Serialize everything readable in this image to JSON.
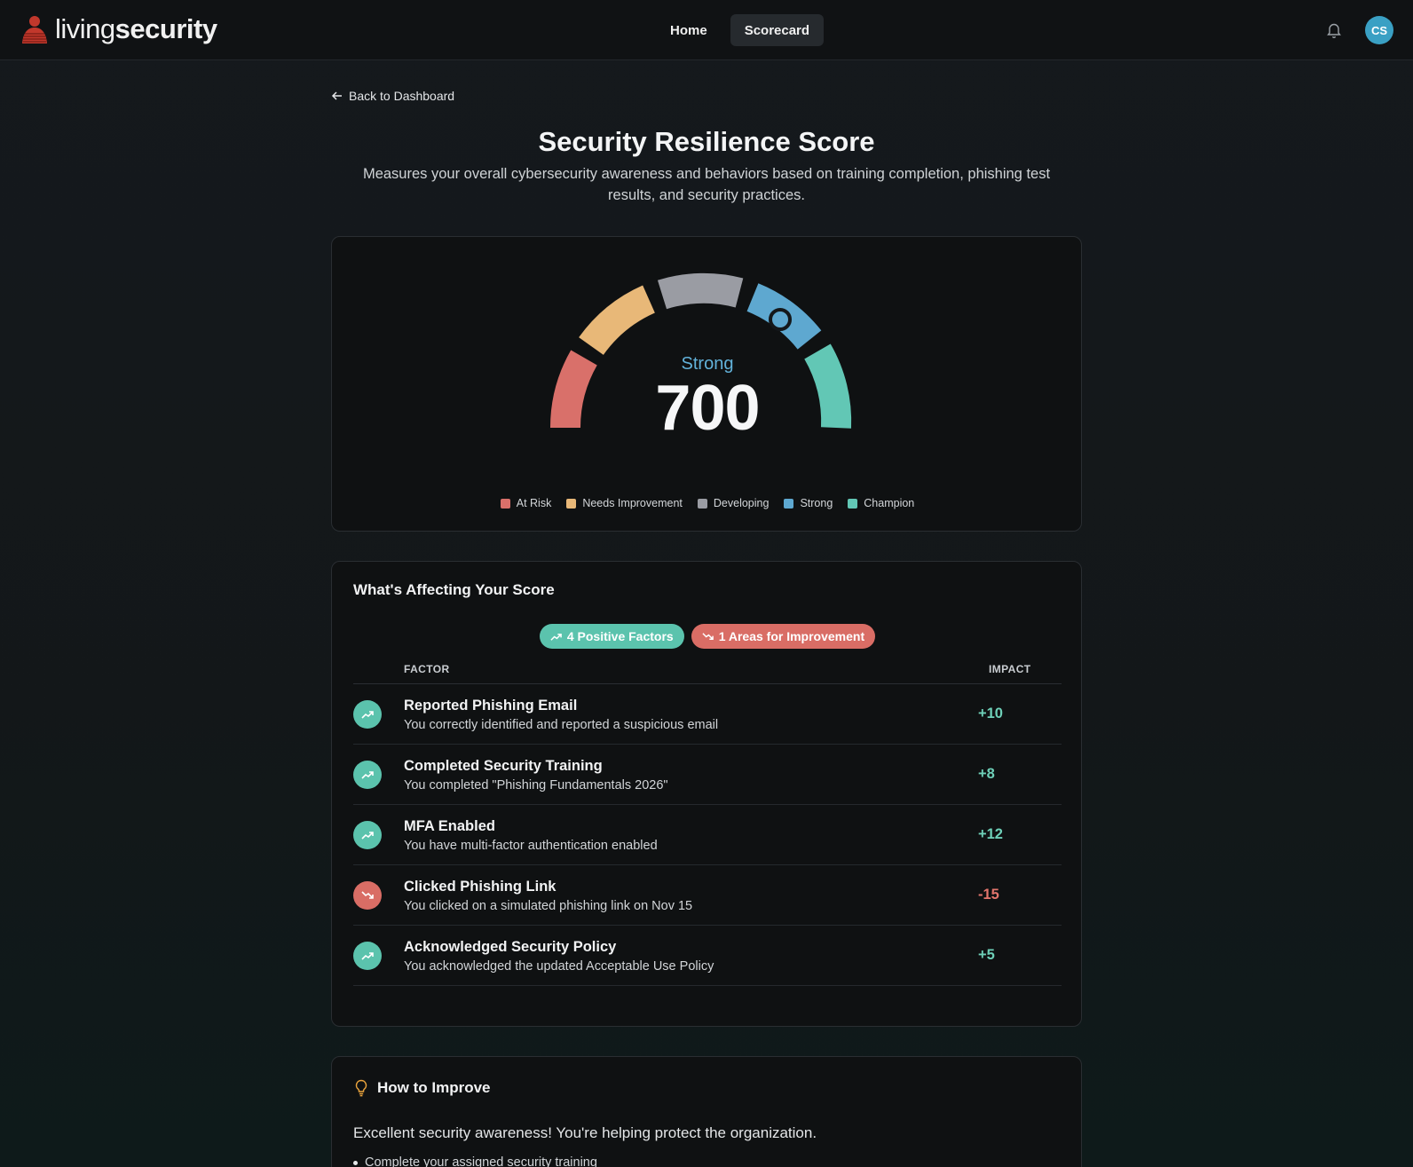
{
  "header": {
    "logo_light": "living",
    "logo_bold": "security",
    "nav": [
      {
        "label": "Home",
        "active": false
      },
      {
        "label": "Scorecard",
        "active": true
      }
    ],
    "notification_icon": "bell-icon",
    "avatar_initials": "CS"
  },
  "back_link": "Back to Dashboard",
  "page": {
    "title": "Security Resilience Score",
    "subtitle": "Measures your overall cybersecurity awareness and behaviors based on training completion, phishing test results, and security practices."
  },
  "gauge": {
    "label": "Strong",
    "score": "700",
    "legend": [
      {
        "label": "At Risk",
        "color": "#d9706a"
      },
      {
        "label": "Needs Improvement",
        "color": "#e8b878"
      },
      {
        "label": "Developing",
        "color": "#9a9ca3"
      },
      {
        "label": "Strong",
        "color": "#5ea8d0"
      },
      {
        "label": "Champion",
        "color": "#62c7b5"
      }
    ]
  },
  "factors": {
    "title": "What's Affecting Your Score",
    "positive_pill": "4 Positive Factors",
    "negative_pill": "1 Areas for Improvement",
    "col_factor": "FACTOR",
    "col_impact": "IMPACT",
    "rows": [
      {
        "title": "Reported Phishing Email",
        "desc": "You correctly identified and reported a suspicious email",
        "impact": "+10",
        "type": "pos"
      },
      {
        "title": "Completed Security Training",
        "desc": "You completed \"Phishing Fundamentals 2026\"",
        "impact": "+8",
        "type": "pos"
      },
      {
        "title": "MFA Enabled",
        "desc": "You have multi-factor authentication enabled",
        "impact": "+12",
        "type": "pos"
      },
      {
        "title": "Clicked Phishing Link",
        "desc": "You clicked on a simulated phishing link on Nov 15",
        "impact": "-15",
        "type": "neg"
      },
      {
        "title": "Acknowledged Security Policy",
        "desc": "You acknowledged the updated Acceptable Use Policy",
        "impact": "+5",
        "type": "pos"
      }
    ]
  },
  "improve": {
    "title": "How to Improve",
    "text": "Excellent security awareness! You're helping protect the organization.",
    "items": [
      "Complete your assigned security training"
    ]
  }
}
